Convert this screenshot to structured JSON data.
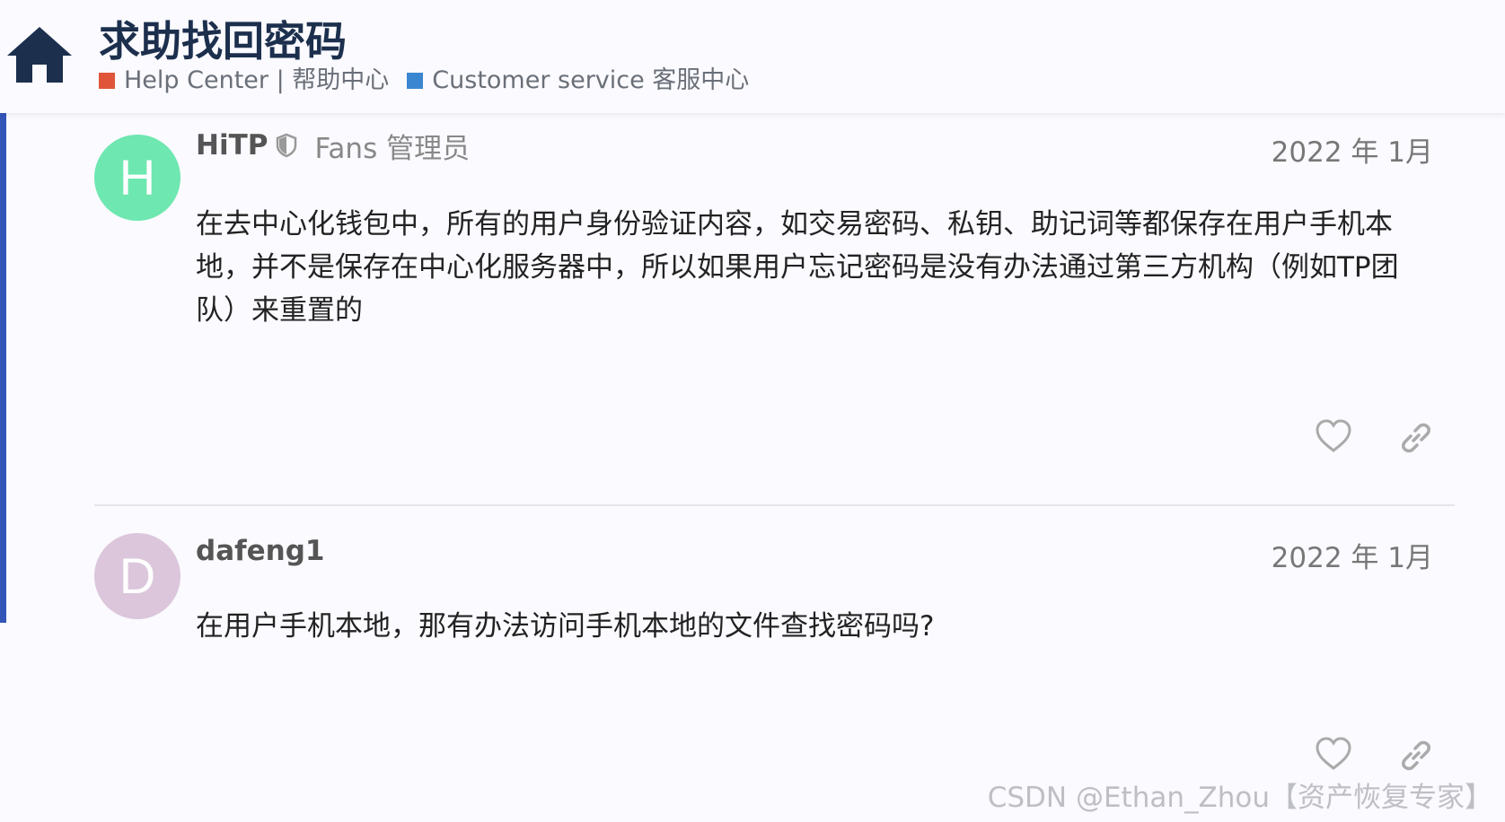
{
  "header": {
    "title": "求助找回密码",
    "home_icon": "home-icon",
    "categories": [
      {
        "label": "Help Center | 帮助中心",
        "color": "#e0553a"
      },
      {
        "label": "Customer service 客服中心",
        "color": "#3a86d1"
      }
    ]
  },
  "posts": [
    {
      "avatar_letter": "H",
      "avatar_color": "#6ee7b0",
      "username": "HiTP",
      "badge_icon": "shield-icon",
      "flair": "Fans 管理员",
      "date": "2022 年 1月",
      "content": "在去中心化钱包中，所有的用户身份验证内容，如交易密码、私钥、助记词等都保存在用户手机本地，并不是保存在中心化服务器中，所以如果用户忘记密码是没有办法通过第三方机构（例如TP团队）来重置的"
    },
    {
      "avatar_letter": "D",
      "avatar_color": "#dcc6dc",
      "username": "dafeng1",
      "date": "2022 年 1月",
      "content": "在用户手机本地，那有办法访问手机本地的文件查找密码吗?"
    }
  ],
  "actions": {
    "like_icon": "heart-icon",
    "share_icon": "link-icon"
  },
  "watermark": "CSDN @Ethan_Zhou【资产恢复专家】"
}
